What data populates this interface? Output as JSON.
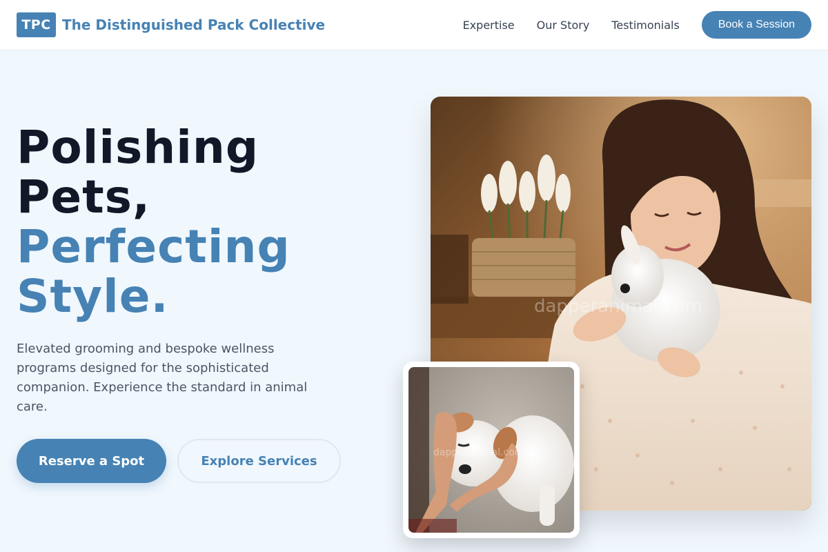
{
  "header": {
    "logo_text": "TPC",
    "brand_name": "The Distinguished Pack Collective",
    "nav": [
      {
        "label": "Expertise"
      },
      {
        "label": "Our Story"
      },
      {
        "label": "Testimonials"
      }
    ],
    "cta_label": "Book a Session"
  },
  "hero": {
    "title_line1": "Polishing",
    "title_line2": "Pets,",
    "title_line3": "Perfecting",
    "title_line4": "Style.",
    "description": "Elevated grooming and bespoke wellness programs designed for the sophisticated companion. Experience the standard in animal care.",
    "primary_button": "Reserve a Spot",
    "secondary_button": "Explore Services"
  },
  "images": {
    "main_watermark": "dapperanimal.com",
    "small_watermark": "dapperanimal.com"
  },
  "colors": {
    "accent": "#4682b4",
    "background": "#f0f7fd",
    "heading": "#111827",
    "body_text": "#4b5563"
  }
}
